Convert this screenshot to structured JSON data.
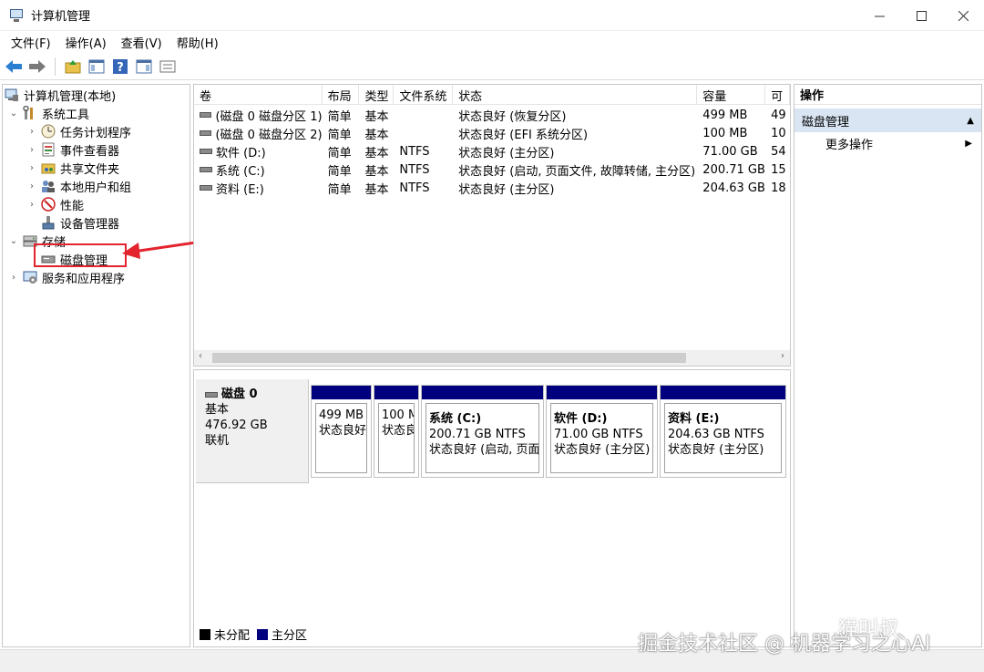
{
  "window": {
    "title": "计算机管理"
  },
  "menu": [
    "文件(F)",
    "操作(A)",
    "查看(V)",
    "帮助(H)"
  ],
  "tree": {
    "root": "计算机管理(本地)",
    "system_tools": "系统工具",
    "task_scheduler": "任务计划程序",
    "event_viewer": "事件查看器",
    "shared_folders": "共享文件夹",
    "local_users": "本地用户和组",
    "performance": "性能",
    "device_manager": "设备管理器",
    "storage": "存储",
    "disk_management": "磁盘管理",
    "services_apps": "服务和应用程序"
  },
  "columns": [
    "卷",
    "布局",
    "类型",
    "文件系统",
    "状态",
    "容量",
    "可"
  ],
  "volumes": [
    {
      "name": "(磁盘 0 磁盘分区 1)",
      "layout": "简单",
      "type": "基本",
      "fs": "",
      "status": "状态良好 (恢复分区)",
      "capacity": "499 MB",
      "free": "49"
    },
    {
      "name": "(磁盘 0 磁盘分区 2)",
      "layout": "简单",
      "type": "基本",
      "fs": "",
      "status": "状态良好 (EFI 系统分区)",
      "capacity": "100 MB",
      "free": "10"
    },
    {
      "name": "软件 (D:)",
      "layout": "简单",
      "type": "基本",
      "fs": "NTFS",
      "status": "状态良好 (主分区)",
      "capacity": "71.00 GB",
      "free": "54"
    },
    {
      "name": "系统 (C:)",
      "layout": "简单",
      "type": "基本",
      "fs": "NTFS",
      "status": "状态良好 (启动, 页面文件, 故障转储, 主分区)",
      "capacity": "200.71 GB",
      "free": "15"
    },
    {
      "name": "资料 (E:)",
      "layout": "简单",
      "type": "基本",
      "fs": "NTFS",
      "status": "状态良好 (主分区)",
      "capacity": "204.63 GB",
      "free": "18"
    }
  ],
  "disk": {
    "name": "磁盘 0",
    "type": "基本",
    "size": "476.92 GB",
    "state": "联机"
  },
  "partitions": [
    {
      "name": "",
      "line1": "499 MB",
      "line2": "状态良好"
    },
    {
      "name": "",
      "line1": "100 M",
      "line2": "状态良"
    },
    {
      "name": "系统  (C:)",
      "line1": "200.71 GB NTFS",
      "line2": "状态良好 (启动, 页面"
    },
    {
      "name": "软件  (D:)",
      "line1": "71.00 GB NTFS",
      "line2": "状态良好 (主分区)"
    },
    {
      "name": "资料  (E:)",
      "line1": "204.63 GB NTFS",
      "line2": "状态良好 (主分区)"
    }
  ],
  "legend": {
    "unallocated": "未分配",
    "primary": "主分区"
  },
  "actions": {
    "header": "操作",
    "section": "磁盘管理",
    "more": "更多操作"
  },
  "watermark": {
    "line1": "掘金技术社区 @ 机器学习之心AI",
    "line2": "猫叫叔"
  },
  "colors": {
    "partition_bar": "#00007f",
    "unallocated": "#000000",
    "action_section_bg": "#d9e5f3",
    "annotation_red": "#e3232d"
  }
}
